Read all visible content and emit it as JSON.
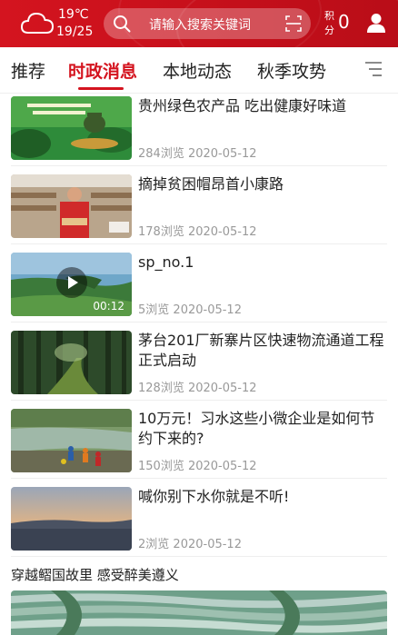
{
  "header": {
    "temperature": "19℃",
    "temp_range": "19/25",
    "search_placeholder": "请输入搜索关键词",
    "points_label": "积分",
    "points_value": "0"
  },
  "tabs": [
    {
      "label": "推荐",
      "active": false
    },
    {
      "label": "时政消息",
      "active": true
    },
    {
      "label": "本地动态",
      "active": false
    },
    {
      "label": "秋季攻势",
      "active": false
    }
  ],
  "feed": [
    {
      "title": "贵州绿色农产品 吃出健康好味道",
      "views": "284浏览",
      "date": "2020-05-12",
      "is_video": false
    },
    {
      "title": "摘掉贫困帽昂首小康路",
      "views": "178浏览",
      "date": "2020-05-12",
      "is_video": false
    },
    {
      "title": "sp_no.1",
      "views": "5浏览",
      "date": "2020-05-12",
      "is_video": true,
      "duration": "00:12"
    },
    {
      "title": "茅台201厂新寨片区快速物流通道工程正式启动",
      "views": "128浏览",
      "date": "2020-05-12",
      "is_video": false
    },
    {
      "title": "10万元！习水这些小微企业是如何节约下来的?",
      "views": "150浏览",
      "date": "2020-05-12",
      "is_video": false
    },
    {
      "title": "喊你别下水你就是不听!",
      "views": "2浏览",
      "date": "2020-05-12",
      "is_video": false
    }
  ],
  "bottom_feature": {
    "title": "穿越鳛国故里 感受醉美遵义"
  },
  "colors": {
    "brand": "#d4141f",
    "meta": "#999999"
  }
}
